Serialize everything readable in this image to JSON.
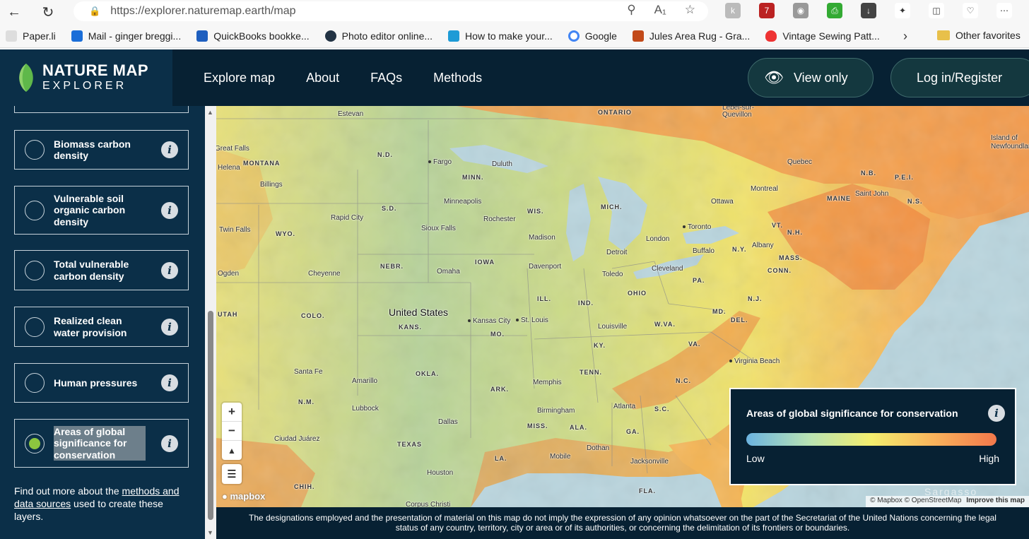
{
  "browser": {
    "url": "https://explorer.naturemap.earth/map",
    "bookmarks": [
      "Paper.li",
      "Mail - ginger breggi...",
      "QuickBooks bookke...",
      "Photo editor online...",
      "How to make your...",
      "Google",
      "Jules Area Rug - Gra...",
      "Vintage Sewing Patt..."
    ],
    "other_favorites": "Other favorites",
    "ext_badge": "7"
  },
  "app": {
    "logo_line1": "NATURE MAP",
    "logo_line2": "EXPLORER",
    "nav": [
      "Explore map",
      "About",
      "FAQs",
      "Methods"
    ],
    "view_only": "View only",
    "login": "Log in/Register"
  },
  "sidebar": {
    "layers": [
      {
        "label": "Biomass carbon density",
        "selected": false
      },
      {
        "label": "Vulnerable soil organic carbon density",
        "selected": false
      },
      {
        "label": "Total vulnerable carbon density",
        "selected": false
      },
      {
        "label": "Realized clean water provision",
        "selected": false
      },
      {
        "label": "Human pressures",
        "selected": false
      },
      {
        "label": "Areas of global significance for conservation",
        "selected": true
      }
    ],
    "footer_pre": "Find out more about the ",
    "footer_link": "methods and data sources",
    "footer_post": " used to create these layers."
  },
  "map": {
    "country": "United States",
    "states": [
      "ONTARIO",
      "MONTANA",
      "N.D.",
      "MINN.",
      "S.D.",
      "WIS.",
      "MICH.",
      "WYO.",
      "NEBR.",
      "IOWA",
      "ILL.",
      "IND.",
      "OHIO",
      "PA.",
      "N.Y.",
      "VT.",
      "N.H.",
      "MAINE",
      "N.B.",
      "P.E.I.",
      "N.S.",
      "MASS.",
      "CONN.",
      "N.J.",
      "MD.",
      "DEL.",
      "W.VA.",
      "VA.",
      "KY.",
      "MO.",
      "KANS.",
      "COLO.",
      "UTAH",
      "N.M.",
      "OKLA.",
      "ARK.",
      "TENN.",
      "N.C.",
      "S.C.",
      "MISS.",
      "ALA.",
      "GA.",
      "TEXAS",
      "LA.",
      "FLA.",
      "CHIH."
    ],
    "cities": [
      "Estevan",
      "Great Falls",
      "Helena",
      "Billings",
      "Fargo",
      "Duluth",
      "Minneapolis",
      "Rochester",
      "Rapid City",
      "Sioux Falls",
      "Madison",
      "Quebec",
      "Montreal",
      "Ottawa",
      "Toronto",
      "Buffalo",
      "London",
      "Detroit",
      "Toledo",
      "Cleveland",
      "Albany",
      "Saint John",
      "Cheyenne",
      "Omaha",
      "Davenport",
      "Kansas City",
      "St. Louis",
      "Louisville",
      "Virginia Beach",
      "Santa Fe",
      "Amarillo",
      "Lubbock",
      "Memphis",
      "Birmingham",
      "Atlanta",
      "Dallas",
      "Ciudad Juárez",
      "Houston",
      "Mobile",
      "Dothan",
      "Jacksonville",
      "Corpus Christi",
      "Lebel-sur-Quevillon",
      "Island of Newfoundland",
      "Twin Falls",
      "Ogden"
    ],
    "legend_title": "Areas of global significance for conservation",
    "legend_low": "Low",
    "legend_high": "High",
    "attribution": "© Mapbox © OpenStreetMap",
    "improve": "Improve this map",
    "mapbox": "mapbox",
    "watermark": "Sargasso"
  },
  "disclaimer": "The designations employed and the presentation of material on this map do not imply the expression of any opinion whatsoever on the part of the Secretariat of the United Nations concerning the legal status of any country, territory, city or area or of its authorities, or concerning the delimitation of its frontiers or boundaries.",
  "colors": {
    "header": "#072133",
    "sidebar": "#0b2f48",
    "accent": "#8cc63f"
  }
}
